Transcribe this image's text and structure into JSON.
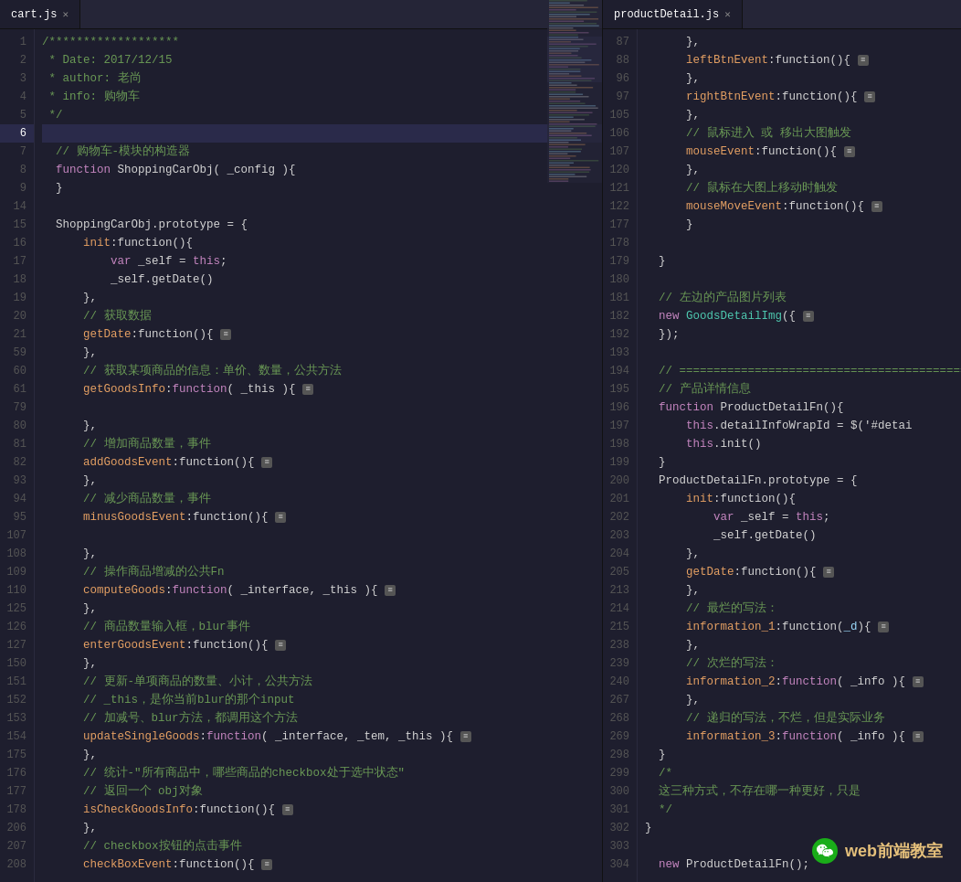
{
  "tabs": {
    "left": {
      "label": "cart.js",
      "active": true
    },
    "right": {
      "label": "productDetail.js",
      "active": true
    }
  },
  "left_code": {
    "lines": [
      {
        "num": "1",
        "content": "/*******************",
        "class": "c-comment"
      },
      {
        "num": "2",
        "content": " * Date: 2017/12/15",
        "class": "c-comment"
      },
      {
        "num": "3",
        "content": " * author: 老尚",
        "class": "c-comment"
      },
      {
        "num": "4",
        "content": " * info: 购物车",
        "class": "c-comment"
      },
      {
        "num": "5",
        "content": " */",
        "class": "c-comment"
      },
      {
        "num": "6",
        "content": "",
        "active": true
      },
      {
        "num": "7",
        "content": "  // 购物车-模块的构造器",
        "class": "c-comment"
      },
      {
        "num": "8",
        "content": "  function ShoppingCarObj( _config ){",
        "mixed": true
      },
      {
        "num": "9",
        "content": "  }",
        "class": "c-white"
      },
      {
        "num": "14",
        "content": "",
        "class": ""
      },
      {
        "num": "15",
        "content": "  ShoppingCarObj.prototype = {",
        "mixed": true
      },
      {
        "num": "16",
        "content": "      init:function(){",
        "method": true
      },
      {
        "num": "17",
        "content": "          var _self = this;",
        "mixed": true
      },
      {
        "num": "18",
        "content": "          _self.getDate()",
        "mixed": true
      },
      {
        "num": "19",
        "content": "      },",
        "class": "c-white"
      },
      {
        "num": "20",
        "content": "      // 获取数据",
        "class": "c-comment"
      },
      {
        "num": "21",
        "content": "      getDate:function(){",
        "method_fold": true
      },
      {
        "num": "59",
        "content": "      },",
        "class": "c-white"
      },
      {
        "num": "60",
        "content": "      // 获取某项商品的信息：单价、数量，公共方法",
        "class": "c-comment"
      },
      {
        "num": "61",
        "content": "      getGoodsInfo:function( _this ){",
        "method_fold": true
      },
      {
        "num": "79",
        "content": "",
        "class": ""
      },
      {
        "num": "80",
        "content": "      },",
        "class": "c-white"
      },
      {
        "num": "81",
        "content": "      // 增加商品数量，事件",
        "class": "c-comment"
      },
      {
        "num": "82",
        "content": "      addGoodsEvent:function(){",
        "method_fold": true
      },
      {
        "num": "93",
        "content": "      },",
        "class": "c-white"
      },
      {
        "num": "94",
        "content": "      // 减少商品数量，事件",
        "class": "c-comment"
      },
      {
        "num": "95",
        "content": "      minusGoodsEvent:function(){",
        "method_fold": true
      },
      {
        "num": "107",
        "content": "",
        "class": ""
      },
      {
        "num": "108",
        "content": "      },",
        "class": "c-white"
      },
      {
        "num": "109",
        "content": "      // 操作商品增减的公共Fn",
        "class": "c-comment"
      },
      {
        "num": "110",
        "content": "      computeGoods:function( _interface, _this ){",
        "method_fold": true
      },
      {
        "num": "125",
        "content": "      },",
        "class": "c-white"
      },
      {
        "num": "126",
        "content": "      // 商品数量输入框，blur事件",
        "class": "c-comment"
      },
      {
        "num": "127",
        "content": "      enterGoodsEvent:function(){",
        "method_fold": true
      },
      {
        "num": "150",
        "content": "      },",
        "class": "c-white"
      },
      {
        "num": "151",
        "content": "      // 更新-单项商品的数量、小计，公共方法",
        "class": "c-comment"
      },
      {
        "num": "152",
        "content": "      // _this，是你当前blur的那个input",
        "class": "c-comment"
      },
      {
        "num": "153",
        "content": "      // 加减号、blur方法，都调用这个方法",
        "class": "c-comment"
      },
      {
        "num": "154",
        "content": "      updateSingleGoods:function( _interface, _tem, _this ){",
        "method_fold": true
      },
      {
        "num": "175",
        "content": "      },",
        "class": "c-white"
      },
      {
        "num": "176",
        "content": "      // 统计-\"所有商品中，哪些商品的checkbox处于选中状态\"",
        "class": "c-comment"
      },
      {
        "num": "177",
        "content": "      // 返回一个 obj对象",
        "class": "c-comment"
      },
      {
        "num": "178",
        "content": "      isCheckGoodsInfo:function(){",
        "method_fold": true
      },
      {
        "num": "206",
        "content": "      },",
        "class": "c-white"
      },
      {
        "num": "207",
        "content": "      // checkbox按钮的点击事件",
        "class": "c-comment"
      },
      {
        "num": "208",
        "content": "      checkBoxEvent:function(){",
        "method_fold": true
      }
    ]
  },
  "right_code": {
    "lines": [
      {
        "num": "87",
        "content": "      },",
        "class": "c-white"
      },
      {
        "num": "88",
        "content": "      leftBtnEvent:function(){",
        "method_fold": true
      },
      {
        "num": "96",
        "content": "      },",
        "class": "c-white"
      },
      {
        "num": "97",
        "content": "      rightBtnEvent:function(){",
        "method_fold": true
      },
      {
        "num": "105",
        "content": "      },",
        "class": "c-white"
      },
      {
        "num": "106",
        "content": "      // 鼠标进入 或 移出大图触发",
        "class": "c-comment"
      },
      {
        "num": "107",
        "content": "      mouseEvent:function(){",
        "method_fold": true
      },
      {
        "num": "120",
        "content": "      },",
        "class": "c-white"
      },
      {
        "num": "121",
        "content": "      // 鼠标在大图上移动时触发",
        "class": "c-comment"
      },
      {
        "num": "122",
        "content": "      mouseMoveEvent:function(){",
        "method_fold": true
      },
      {
        "num": "177",
        "content": "      }",
        "class": "c-white"
      },
      {
        "num": "178",
        "content": "",
        "class": ""
      },
      {
        "num": "179",
        "content": "  }",
        "class": "c-white"
      },
      {
        "num": "180",
        "content": "",
        "class": ""
      },
      {
        "num": "181",
        "content": "  // 左边的产品图片列表",
        "class": "c-comment"
      },
      {
        "num": "182",
        "content": "  new GoodsDetailImg({",
        "mixed_cn": true
      },
      {
        "num": "192",
        "content": "  });",
        "class": "c-white"
      },
      {
        "num": "193",
        "content": "",
        "class": ""
      },
      {
        "num": "194",
        "content": "  // ===========================================",
        "class": "c-comment"
      },
      {
        "num": "195",
        "content": "  // 产品详情信息",
        "class": "c-comment"
      },
      {
        "num": "196",
        "content": "  function ProductDetailFn(){",
        "mixed": true
      },
      {
        "num": "197",
        "content": "      this.detailInfoWrapId = $('#detai",
        "mixed_trunc": true
      },
      {
        "num": "198",
        "content": "      this.init()",
        "mixed": true
      },
      {
        "num": "199",
        "content": "  }",
        "class": "c-white"
      },
      {
        "num": "200",
        "content": "  ProductDetailFn.prototype = {",
        "mixed": true
      },
      {
        "num": "201",
        "content": "      init:function(){",
        "method": true
      },
      {
        "num": "202",
        "content": "          var _self = this;",
        "mixed": true
      },
      {
        "num": "203",
        "content": "          _self.getDate()",
        "mixed": true
      },
      {
        "num": "204",
        "content": "      },",
        "class": "c-white"
      },
      {
        "num": "205",
        "content": "      getDate:function(){",
        "method_fold": true
      },
      {
        "num": "213",
        "content": "      },",
        "class": "c-white"
      },
      {
        "num": "214",
        "content": "      // 最烂的写法：",
        "class": "c-comment"
      },
      {
        "num": "215",
        "content": "      information_1:function(_d){",
        "method_fold": true
      },
      {
        "num": "238",
        "content": "      },",
        "class": "c-white"
      },
      {
        "num": "239",
        "content": "      // 次烂的写法：",
        "class": "c-comment"
      },
      {
        "num": "240",
        "content": "      information_2:function( _info ){",
        "method_fold_trunc": true
      },
      {
        "num": "267",
        "content": "      },",
        "class": "c-white"
      },
      {
        "num": "268",
        "content": "      // 递归的写法，不烂，但是实际业务",
        "class": "c-comment_trunc"
      },
      {
        "num": "269",
        "content": "      information_3:function( _info ){",
        "method_fold_trunc": true
      },
      {
        "num": "298",
        "content": "  }",
        "class": "c-white"
      },
      {
        "num": "299",
        "content": "  /*",
        "class": "c-comment"
      },
      {
        "num": "300",
        "content": "  这三种方式，不存在哪一种更好，只是",
        "class": "c-comment_trunc"
      },
      {
        "num": "301",
        "content": "  */",
        "class": "c-comment"
      },
      {
        "num": "302",
        "content": "}",
        "class": "c-white"
      },
      {
        "num": "303",
        "content": "",
        "class": ""
      },
      {
        "num": "304",
        "content": "  new ProductDetailFn();",
        "mixed": true
      }
    ]
  },
  "watermark": {
    "text": "web前端教室"
  }
}
